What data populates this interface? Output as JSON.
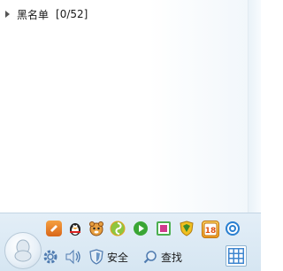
{
  "contact_list": {
    "groups": [
      {
        "name": "黑名单",
        "count": "[0/52]"
      }
    ]
  },
  "app_bar": {
    "icons": [
      {
        "name": "pencil-icon",
        "color": "#e8801a",
        "glyph": "✎"
      },
      {
        "name": "penguin-icon",
        "color": "#2b2b2b",
        "glyph": ""
      },
      {
        "name": "pet-icon",
        "color": "#d98b2b",
        "glyph": ""
      },
      {
        "name": "swirl-icon",
        "color": "#7fb82a",
        "glyph": ""
      },
      {
        "name": "play-icon",
        "color": "#3aa635",
        "glyph": "▶"
      },
      {
        "name": "photo-icon",
        "color": "#3a9a3a",
        "glyph": ""
      },
      {
        "name": "shield-game-icon",
        "color": "#e5b21c",
        "glyph": ""
      },
      {
        "name": "calendar-icon",
        "color": "#f0a020",
        "glyph": "18"
      },
      {
        "name": "globe-icon",
        "color": "#2a7fd0",
        "glyph": ""
      }
    ]
  },
  "toolbar": {
    "security_label": "安全",
    "search_label": "查找"
  }
}
